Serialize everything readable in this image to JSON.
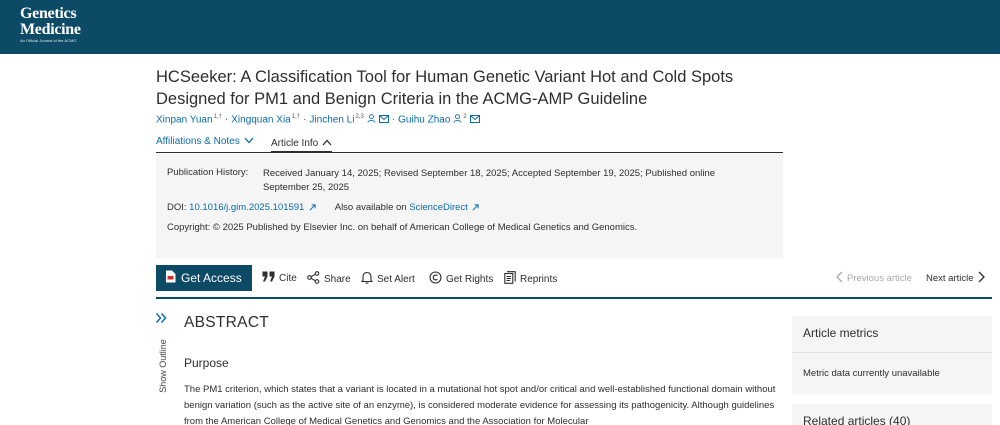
{
  "header": {
    "logo_line1": "Genetics",
    "logo_line2": "Medicine",
    "logo_subtitle": "An Official Journal of the ACMG"
  },
  "article": {
    "title": "HCSeeker: A Classification Tool for Human Genetic Variant Hot and Cold Spots Designed for PM1 and Benign Criteria in the ACMG-AMP Guideline",
    "authors": [
      {
        "name": "Xinpan Yuan",
        "sup": "1,†"
      },
      {
        "name": "Xingquan Xia",
        "sup": "1,†"
      },
      {
        "name": "Jinchen Li",
        "sup": "2,3"
      },
      {
        "name": "Guihu Zhao",
        "sup": "2"
      }
    ]
  },
  "tabs": {
    "affiliations": "Affiliations & Notes",
    "article_info": "Article Info"
  },
  "info": {
    "publication_history_label": "Publication History:",
    "publication_history_text": "Received January 14, 2025; Revised September 18, 2025; Accepted September 19, 2025; Published online September 25, 2025",
    "doi_label": "DOI:",
    "doi_value": "10.1016/j.gim.2025.101591",
    "also_available": "Also available on",
    "sciencedirect": "ScienceDirect",
    "copyright": "Copyright: © 2025 Published by Elsevier Inc. on behalf of American College of Medical Genetics and Genomics."
  },
  "actions": {
    "get_access": "Get Access",
    "cite": "Cite",
    "share": "Share",
    "set_alert": "Set Alert",
    "get_rights": "Get Rights",
    "reprints": "Reprints",
    "previous_article": "Previous article",
    "next_article": "Next article"
  },
  "outline": {
    "label": "Show Outline"
  },
  "abstract": {
    "heading": "ABSTRACT",
    "purpose_heading": "Purpose",
    "paragraph": "The PM1 criterion, which states that a variant is located in a mutational hot spot and/or critical and well-established functional domain without benign variation (such as the active site of an enzyme), is considered moderate evidence for assessing its pathogenicity. Although guidelines from the American College of Medical Genetics and Genomics and the Association for Molecular"
  },
  "sidebar": {
    "metrics_heading": "Article metrics",
    "metrics_text": "Metric data currently unavailable",
    "related_heading": "Related articles (40)"
  },
  "colors": {
    "brand": "#0d4a66",
    "link": "#0c6ca8",
    "panel": "#f5f5f5"
  }
}
